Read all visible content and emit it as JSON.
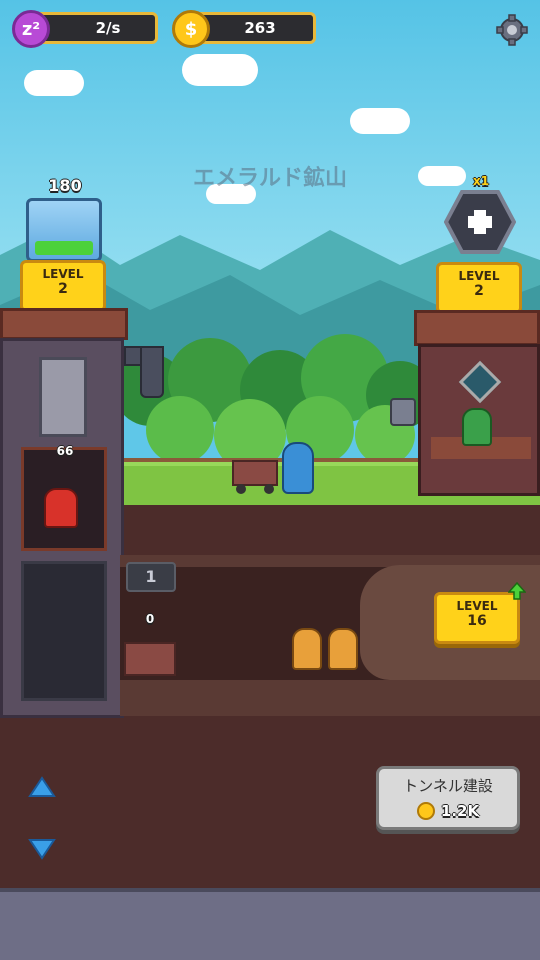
{
  "hud": {
    "income_rate": "2/s",
    "coins": "263",
    "income_icon_text": "z²",
    "settings_icon": "gear-icon"
  },
  "mine": {
    "title": "エメラルド鉱山"
  },
  "elevator": {
    "stored": "180",
    "level_label": "LEVEL",
    "level_value": "2",
    "carry_amount": "66"
  },
  "warehouse": {
    "multiplier": "x1",
    "level_label": "LEVEL",
    "level_value": "2"
  },
  "shaft": {
    "number": "1",
    "cart_amount": "0",
    "level_label": "LEVEL",
    "level_value": "16"
  },
  "build_tunnel": {
    "label": "トンネル建設",
    "cost": "1.2K"
  },
  "colors": {
    "accent_yellow": "#ffd21a",
    "gem_green": "#4cd13a",
    "dirt": "#4c2c2a"
  }
}
